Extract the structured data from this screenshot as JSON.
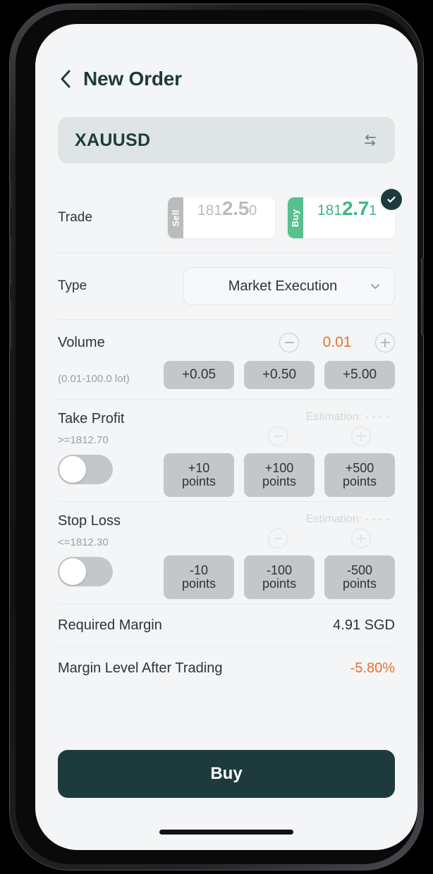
{
  "header": {
    "back_icon": "chevron-left-icon",
    "title": "New Order"
  },
  "symbol": {
    "name": "XAUUSD",
    "swap_icon": "swap-arrows-icon"
  },
  "trade": {
    "label": "Trade",
    "sell": {
      "tab_label": "Sell",
      "price_prefix": "181",
      "price_main": "2.5",
      "price_suffix": "0",
      "full_price": "1812.50",
      "color": "#b9bcbd",
      "selected": false
    },
    "buy": {
      "tab_label": "Buy",
      "price_prefix": "181",
      "price_main": "2.7",
      "price_suffix": "1",
      "full_price": "1812.71",
      "color": "#3cb882",
      "selected": true,
      "check_icon": "check-circle-icon"
    }
  },
  "type": {
    "label": "Type",
    "value": "Market Execution",
    "chevron_icon": "chevron-down-icon"
  },
  "volume": {
    "label": "Volume",
    "range_hint": "(0.01-100.0 lot)",
    "value": "0.01",
    "value_color": "#e8722c",
    "minus_icon": "minus-circle-icon",
    "plus_icon": "plus-circle-icon",
    "chips": [
      "+0.05",
      "+0.50",
      "+5.00"
    ]
  },
  "take_profit": {
    "label": "Take Profit",
    "condition": ">=1812.70",
    "estimation": "Estimation: - - - -",
    "enabled": false,
    "minus_icon": "minus-circle-icon",
    "plus_icon": "plus-circle-icon",
    "chips": [
      {
        "amount": "+10",
        "unit": "points"
      },
      {
        "amount": "+100",
        "unit": "points"
      },
      {
        "amount": "+500",
        "unit": "points"
      }
    ]
  },
  "stop_loss": {
    "label": "Stop Loss",
    "condition": "<=1812.30",
    "estimation": "Estimation: - - - -",
    "enabled": false,
    "minus_icon": "minus-circle-icon",
    "plus_icon": "plus-circle-icon",
    "chips": [
      {
        "amount": "-10",
        "unit": "points"
      },
      {
        "amount": "-100",
        "unit": "points"
      },
      {
        "amount": "-500",
        "unit": "points"
      }
    ]
  },
  "summary": [
    {
      "label": "Required Margin",
      "value": "4.91 SGD",
      "negative": false
    },
    {
      "label": "Margin Level After Trading",
      "value": "-5.80%",
      "negative": true
    }
  ],
  "cta": {
    "label": "Buy"
  }
}
